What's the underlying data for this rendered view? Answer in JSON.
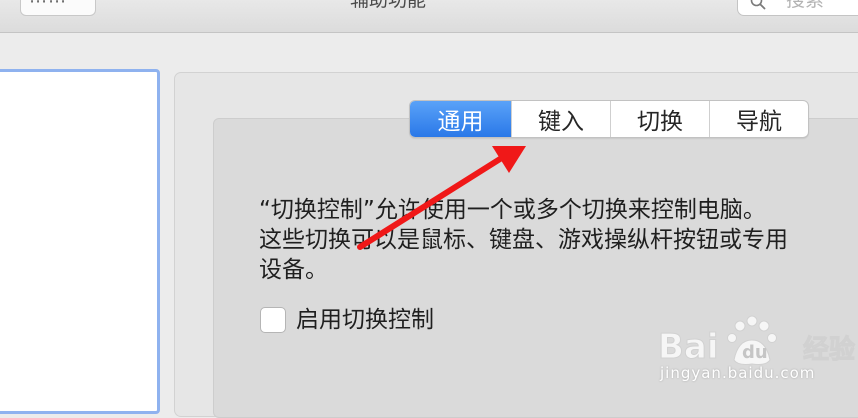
{
  "window": {
    "title": "辅助功能"
  },
  "toolbar": {
    "grid_icon": "grid-icon",
    "grid_glyph": "⋯⋯",
    "search_placeholder": "搜索",
    "search_icon": "search-icon"
  },
  "tabs": [
    {
      "label": "通用",
      "active": true
    },
    {
      "label": "键入",
      "active": false
    },
    {
      "label": "切换",
      "active": false
    },
    {
      "label": "导航",
      "active": false
    }
  ],
  "description": "“切换控制”允许使用一个或多个切换来控制电脑。\n这些切换可以是鼠标、键盘、游戏操纵杆按钮或专用\n设备。",
  "checkbox": {
    "label": "启用切换控制",
    "checked": false
  },
  "watermark": {
    "logo_text": "Bai du 经验",
    "url": "jingyan.baidu.com"
  },
  "colors": {
    "accent_tab": "#2a78e8",
    "annotation_arrow": "#f01818",
    "list_focus_ring": "#8fb2ef"
  }
}
